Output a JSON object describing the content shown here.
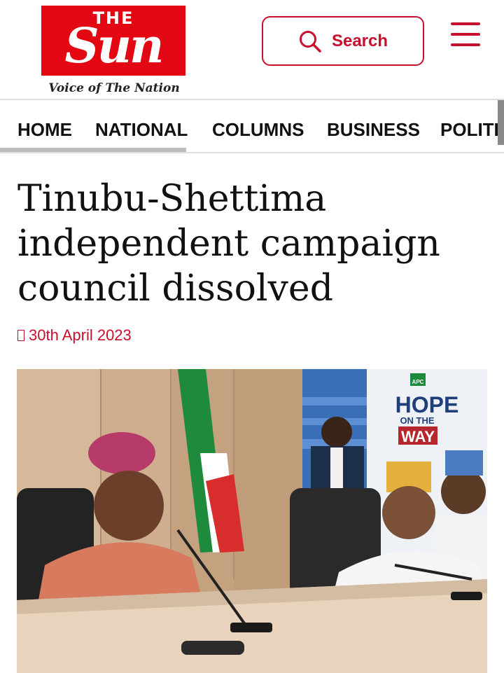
{
  "site": {
    "logo_the": "THE",
    "logo_sun": "Sun",
    "tagline": "Voice of The Nation",
    "brand_color": "#e30613"
  },
  "header": {
    "search_label": "Search",
    "search_icon": "search-icon",
    "menu_icon": "hamburger-menu-icon"
  },
  "nav": {
    "items": [
      "HOME",
      "NATIONAL",
      "COLUMNS",
      "BUSINESS",
      "POLITICS"
    ]
  },
  "article": {
    "headline": "Tinubu-Shettima independent campaign council dissolved",
    "date": "30th April 2023",
    "date_icon": "calendar-icon"
  },
  "photo": {
    "poster_logo": "APC",
    "poster_line1": "HOPE",
    "poster_line2": "ON THE",
    "poster_line3": "WAY"
  }
}
